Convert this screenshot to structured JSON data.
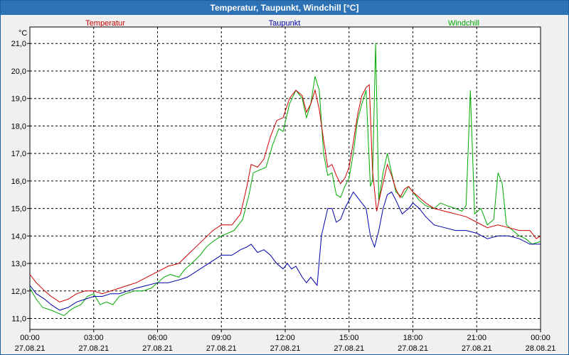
{
  "window": {
    "title": "Temperatur, Taupunkt, Windchill [°C]"
  },
  "chart_data": {
    "type": "line",
    "title": "Temperatur, Taupunkt, Windchill [°C]",
    "yunit": "°C",
    "ylim": [
      10.6,
      21.6
    ],
    "y_ticks": [
      "11,0",
      "12,0",
      "13,0",
      "14,0",
      "15,0",
      "16,0",
      "17,0",
      "18,0",
      "19,0",
      "20,0",
      "21,0"
    ],
    "y_tick_values": [
      11,
      12,
      13,
      14,
      15,
      16,
      17,
      18,
      19,
      20,
      21
    ],
    "x_range_hours": [
      0,
      24
    ],
    "x_ticks": [
      {
        "time": "00:00",
        "date": "27.08.21",
        "hour": 0
      },
      {
        "time": "03:00",
        "date": "27.08.21",
        "hour": 3
      },
      {
        "time": "06:00",
        "date": "27.08.21",
        "hour": 6
      },
      {
        "time": "09:00",
        "date": "27.08.21",
        "hour": 9
      },
      {
        "time": "12:00",
        "date": "27.08.21",
        "hour": 12
      },
      {
        "time": "15:00",
        "date": "27.08.21",
        "hour": 15
      },
      {
        "time": "18:00",
        "date": "27.08.21",
        "hour": 18
      },
      {
        "time": "21:00",
        "date": "27.08.21",
        "hour": 21
      },
      {
        "time": "00:00",
        "date": "28.08.21",
        "hour": 24
      }
    ],
    "grid": true,
    "legend_position": "top",
    "series": [
      {
        "name": "Temperatur",
        "color": "#cc0000",
        "points": [
          [
            0,
            12.6
          ],
          [
            0.3,
            12.3
          ],
          [
            0.7,
            12.0
          ],
          [
            1.0,
            11.8
          ],
          [
            1.4,
            11.6
          ],
          [
            1.8,
            11.7
          ],
          [
            2.2,
            11.9
          ],
          [
            2.6,
            12.0
          ],
          [
            3.0,
            12.0
          ],
          [
            3.4,
            11.9
          ],
          [
            3.8,
            12.0
          ],
          [
            4.2,
            12.1
          ],
          [
            4.6,
            12.2
          ],
          [
            5.0,
            12.3
          ],
          [
            5.5,
            12.5
          ],
          [
            6.0,
            12.7
          ],
          [
            6.5,
            12.9
          ],
          [
            7.0,
            13.0
          ],
          [
            7.4,
            13.3
          ],
          [
            7.8,
            13.6
          ],
          [
            8.2,
            13.9
          ],
          [
            8.6,
            14.2
          ],
          [
            9.0,
            14.4
          ],
          [
            9.5,
            14.4
          ],
          [
            9.9,
            14.8
          ],
          [
            10.2,
            15.8
          ],
          [
            10.4,
            16.6
          ],
          [
            10.7,
            16.5
          ],
          [
            11.0,
            16.8
          ],
          [
            11.3,
            17.6
          ],
          [
            11.6,
            18.2
          ],
          [
            11.9,
            18.3
          ],
          [
            12.2,
            19.0
          ],
          [
            12.5,
            19.3
          ],
          [
            12.8,
            19.1
          ],
          [
            13.0,
            18.5
          ],
          [
            13.2,
            18.8
          ],
          [
            13.4,
            19.3
          ],
          [
            13.6,
            18.6
          ],
          [
            13.8,
            17.5
          ],
          [
            14.0,
            16.5
          ],
          [
            14.2,
            16.6
          ],
          [
            14.4,
            16.2
          ],
          [
            14.6,
            15.9
          ],
          [
            14.8,
            16.1
          ],
          [
            15.0,
            16.5
          ],
          [
            15.2,
            17.4
          ],
          [
            15.4,
            18.4
          ],
          [
            15.6,
            19.1
          ],
          [
            15.8,
            19.4
          ],
          [
            15.95,
            19.5
          ],
          [
            16.1,
            16.4
          ],
          [
            16.3,
            14.9
          ],
          [
            16.5,
            15.6
          ],
          [
            16.8,
            16.6
          ],
          [
            17.0,
            16.2
          ],
          [
            17.2,
            15.7
          ],
          [
            17.4,
            15.4
          ],
          [
            17.6,
            15.7
          ],
          [
            17.8,
            15.8
          ],
          [
            18.0,
            15.6
          ],
          [
            18.3,
            15.4
          ],
          [
            18.6,
            15.2
          ],
          [
            19.0,
            15.0
          ],
          [
            19.5,
            14.9
          ],
          [
            20.0,
            14.8
          ],
          [
            20.5,
            14.7
          ],
          [
            21.0,
            14.5
          ],
          [
            21.5,
            14.3
          ],
          [
            22.0,
            14.4
          ],
          [
            22.5,
            14.3
          ],
          [
            23.0,
            14.2
          ],
          [
            23.5,
            14.2
          ],
          [
            23.8,
            13.9
          ],
          [
            24.0,
            14.0
          ]
        ]
      },
      {
        "name": "Taupunkt",
        "color": "#0000aa",
        "points": [
          [
            0,
            12.2
          ],
          [
            0.3,
            11.9
          ],
          [
            0.7,
            11.7
          ],
          [
            1.0,
            11.5
          ],
          [
            1.4,
            11.3
          ],
          [
            1.8,
            11.4
          ],
          [
            2.2,
            11.6
          ],
          [
            2.6,
            11.7
          ],
          [
            3.0,
            11.8
          ],
          [
            3.4,
            11.8
          ],
          [
            3.8,
            11.9
          ],
          [
            4.2,
            11.9
          ],
          [
            4.6,
            12.0
          ],
          [
            5.0,
            12.1
          ],
          [
            5.5,
            12.2
          ],
          [
            6.0,
            12.3
          ],
          [
            6.5,
            12.3
          ],
          [
            7.0,
            12.4
          ],
          [
            7.4,
            12.5
          ],
          [
            7.8,
            12.7
          ],
          [
            8.2,
            12.9
          ],
          [
            8.6,
            13.1
          ],
          [
            9.0,
            13.3
          ],
          [
            9.5,
            13.3
          ],
          [
            9.9,
            13.5
          ],
          [
            10.2,
            13.6
          ],
          [
            10.4,
            13.7
          ],
          [
            10.7,
            13.4
          ],
          [
            11.0,
            13.5
          ],
          [
            11.3,
            13.3
          ],
          [
            11.6,
            13.0
          ],
          [
            11.9,
            12.8
          ],
          [
            12.1,
            13.0
          ],
          [
            12.3,
            12.8
          ],
          [
            12.5,
            12.9
          ],
          [
            12.8,
            12.5
          ],
          [
            13.0,
            12.3
          ],
          [
            13.2,
            12.5
          ],
          [
            13.4,
            12.3
          ],
          [
            13.5,
            12.2
          ],
          [
            13.7,
            14.0
          ],
          [
            14.0,
            15.0
          ],
          [
            14.2,
            15.0
          ],
          [
            14.4,
            14.5
          ],
          [
            14.6,
            14.6
          ],
          [
            14.8,
            15.0
          ],
          [
            15.0,
            15.3
          ],
          [
            15.2,
            15.6
          ],
          [
            15.4,
            15.4
          ],
          [
            15.6,
            15.2
          ],
          [
            15.8,
            15.0
          ],
          [
            16.0,
            14.0
          ],
          [
            16.2,
            13.6
          ],
          [
            16.4,
            14.2
          ],
          [
            16.6,
            15.0
          ],
          [
            16.8,
            15.5
          ],
          [
            17.0,
            15.6
          ],
          [
            17.2,
            15.3
          ],
          [
            17.5,
            14.8
          ],
          [
            17.8,
            15.0
          ],
          [
            18.0,
            15.2
          ],
          [
            18.3,
            15.0
          ],
          [
            18.6,
            14.7
          ],
          [
            19.0,
            14.4
          ],
          [
            19.5,
            14.3
          ],
          [
            20.0,
            14.2
          ],
          [
            20.5,
            14.2
          ],
          [
            21.0,
            14.1
          ],
          [
            21.5,
            13.9
          ],
          [
            22.0,
            14.0
          ],
          [
            22.5,
            14.0
          ],
          [
            23.0,
            13.9
          ],
          [
            23.5,
            13.7
          ],
          [
            24.0,
            13.7
          ]
        ]
      },
      {
        "name": "Windchill",
        "color": "#00aa00",
        "points": [
          [
            0,
            12.1
          ],
          [
            0.3,
            11.7
          ],
          [
            0.6,
            11.4
          ],
          [
            1.0,
            11.3
          ],
          [
            1.3,
            11.2
          ],
          [
            1.6,
            11.1
          ],
          [
            1.9,
            11.3
          ],
          [
            2.1,
            11.4
          ],
          [
            2.4,
            11.5
          ],
          [
            2.7,
            11.8
          ],
          [
            3.0,
            11.9
          ],
          [
            3.3,
            11.5
          ],
          [
            3.6,
            11.6
          ],
          [
            3.9,
            11.5
          ],
          [
            4.2,
            11.8
          ],
          [
            4.5,
            11.9
          ],
          [
            4.9,
            12.0
          ],
          [
            5.3,
            12.0
          ],
          [
            5.7,
            12.1
          ],
          [
            6.0,
            12.3
          ],
          [
            6.3,
            12.5
          ],
          [
            6.6,
            12.6
          ],
          [
            7.0,
            12.5
          ],
          [
            7.3,
            12.8
          ],
          [
            7.6,
            13.0
          ],
          [
            8.0,
            13.3
          ],
          [
            8.3,
            13.6
          ],
          [
            8.6,
            13.8
          ],
          [
            9.0,
            14.0
          ],
          [
            9.3,
            14.1
          ],
          [
            9.6,
            14.2
          ],
          [
            10.0,
            14.6
          ],
          [
            10.3,
            15.5
          ],
          [
            10.5,
            16.3
          ],
          [
            10.8,
            16.4
          ],
          [
            11.1,
            16.5
          ],
          [
            11.4,
            17.3
          ],
          [
            11.7,
            17.9
          ],
          [
            11.9,
            17.8
          ],
          [
            12.2,
            18.8
          ],
          [
            12.5,
            19.3
          ],
          [
            12.8,
            19.0
          ],
          [
            13.0,
            18.3
          ],
          [
            13.2,
            18.8
          ],
          [
            13.4,
            19.8
          ],
          [
            13.6,
            19.3
          ],
          [
            13.8,
            17.0
          ],
          [
            14.0,
            16.2
          ],
          [
            14.2,
            16.3
          ],
          [
            14.4,
            15.5
          ],
          [
            14.6,
            15.4
          ],
          [
            14.8,
            15.8
          ],
          [
            15.0,
            16.1
          ],
          [
            15.2,
            17.0
          ],
          [
            15.4,
            18.2
          ],
          [
            15.6,
            18.8
          ],
          [
            15.8,
            19.3
          ],
          [
            16.0,
            15.8
          ],
          [
            16.1,
            16.0
          ],
          [
            16.25,
            21.0
          ],
          [
            16.4,
            15.3
          ],
          [
            16.6,
            16.3
          ],
          [
            16.8,
            17.0
          ],
          [
            17.0,
            16.3
          ],
          [
            17.2,
            15.6
          ],
          [
            17.5,
            15.4
          ],
          [
            17.8,
            15.8
          ],
          [
            18.0,
            15.6
          ],
          [
            18.3,
            15.3
          ],
          [
            18.6,
            15.1
          ],
          [
            19.0,
            15.0
          ],
          [
            19.3,
            15.2
          ],
          [
            19.6,
            15.1
          ],
          [
            20.0,
            15.0
          ],
          [
            20.3,
            14.9
          ],
          [
            20.5,
            15.1
          ],
          [
            20.7,
            19.3
          ],
          [
            20.9,
            14.8
          ],
          [
            21.2,
            15.0
          ],
          [
            21.5,
            14.4
          ],
          [
            21.8,
            14.6
          ],
          [
            22.0,
            16.3
          ],
          [
            22.2,
            15.9
          ],
          [
            22.4,
            14.4
          ],
          [
            22.7,
            14.2
          ],
          [
            23.0,
            14.0
          ],
          [
            23.3,
            13.9
          ],
          [
            23.6,
            13.7
          ],
          [
            24.0,
            13.8
          ]
        ]
      }
    ]
  }
}
